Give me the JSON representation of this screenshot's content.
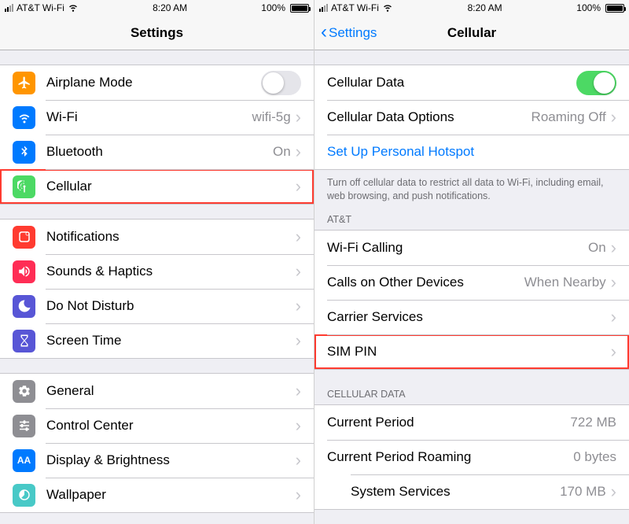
{
  "status": {
    "carrier": "AT&T Wi-Fi",
    "time": "8:20 AM",
    "battery": "100%"
  },
  "left": {
    "title": "Settings",
    "rows": {
      "airplane": "Airplane Mode",
      "wifi": "Wi-Fi",
      "wifi_value": "wifi-5g",
      "bluetooth": "Bluetooth",
      "bluetooth_value": "On",
      "cellular": "Cellular",
      "notifications": "Notifications",
      "sounds": "Sounds & Haptics",
      "dnd": "Do Not Disturb",
      "screentime": "Screen Time",
      "general": "General",
      "control": "Control Center",
      "display": "Display & Brightness",
      "wallpaper": "Wallpaper"
    }
  },
  "right": {
    "back": "Settings",
    "title": "Cellular",
    "rows": {
      "cellular_data": "Cellular Data",
      "options": "Cellular Data Options",
      "options_value": "Roaming Off",
      "hotspot": "Set Up Personal Hotspot",
      "wifi_calling": "Wi-Fi Calling",
      "wifi_calling_value": "On",
      "calls_other": "Calls on Other Devices",
      "calls_other_value": "When Nearby",
      "carrier_services": "Carrier Services",
      "sim_pin": "SIM PIN",
      "current_period": "Current Period",
      "current_period_value": "722 MB",
      "roaming": "Current Period Roaming",
      "roaming_value": "0 bytes",
      "system_services": "System Services",
      "system_services_value": "170 MB"
    },
    "footer1": "Turn off cellular data to restrict all data to Wi-Fi, including email, web browsing, and push notifications.",
    "header_att": "AT&T",
    "header_cellular_data": "CELLULAR DATA"
  }
}
